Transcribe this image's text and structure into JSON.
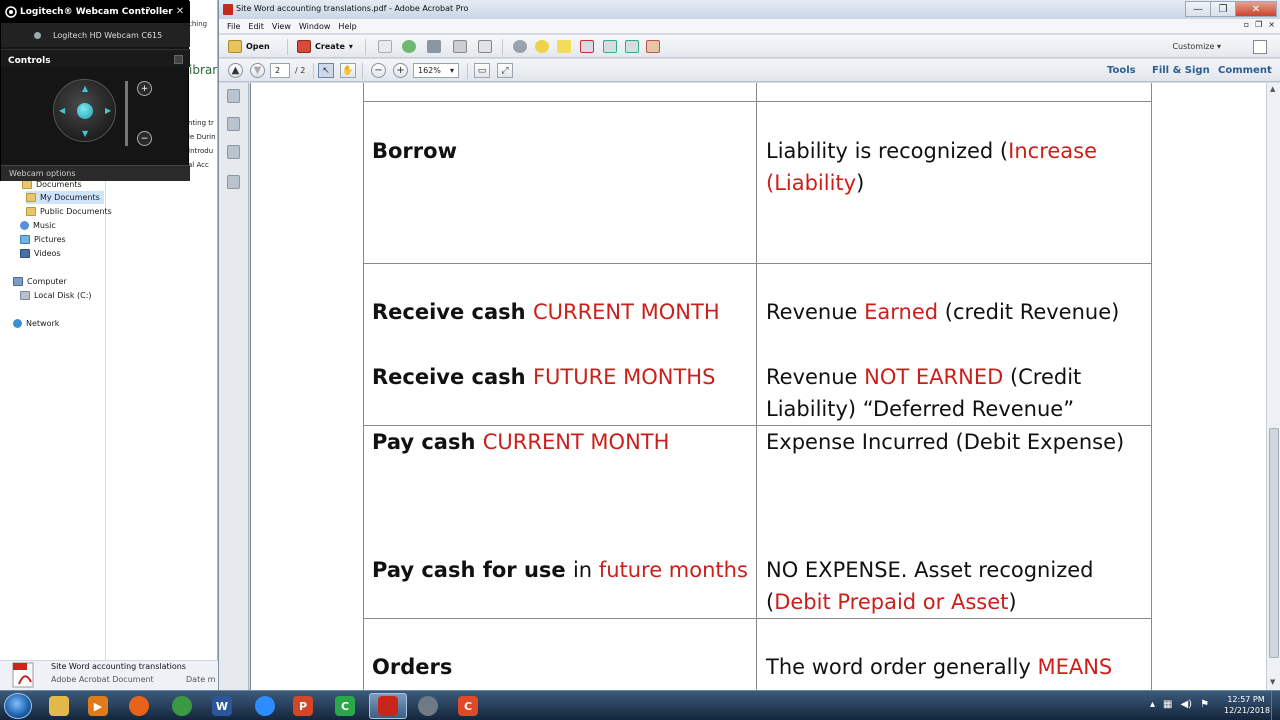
{
  "explorer": {
    "tree": [
      {
        "label": "Documents",
        "icon": "folder-icon",
        "indent": 1
      },
      {
        "label": "My Documents",
        "icon": "folder-icon",
        "indent": 2,
        "selected": true
      },
      {
        "label": "Public Documents",
        "icon": "folder-icon",
        "indent": 2
      },
      {
        "label": "Music",
        "icon": "music-icon",
        "indent": 1
      },
      {
        "label": "Pictures",
        "icon": "pictures-icon",
        "indent": 1
      },
      {
        "label": "Videos",
        "icon": "videos-icon",
        "indent": 1
      },
      {
        "label": "Computer",
        "icon": "computer-icon",
        "indent": 0
      },
      {
        "label": "Local Disk (C:)",
        "icon": "disk-icon",
        "indent": 1
      },
      {
        "label": "Network",
        "icon": "network-icon",
        "indent": 0
      }
    ],
    "title_fragment": "ching",
    "library_fragment": "ibrar",
    "file_fragments": [
      "nting tr",
      "le Durin",
      "Introdu",
      "al Acc"
    ],
    "status": {
      "title": "Site Word accounting translations",
      "type": "Adobe Acrobat Document",
      "date_label": "Date m"
    }
  },
  "webcam": {
    "title": "Logitech® Webcam Controller",
    "help_glyph": "?",
    "minimize_glyph": "—",
    "close_glyph": "✕",
    "device": "Logitech HD Webcam C615",
    "controls_label": "Controls",
    "options_label": "Webcam options"
  },
  "acrobat": {
    "title": "Site Word accounting translations.pdf - Adobe Acrobat Pro",
    "menu": [
      "File",
      "Edit",
      "View",
      "Window",
      "Help"
    ],
    "toolbar": {
      "open_label": "Open",
      "create_label": "Create",
      "customize_label": "Customize"
    },
    "nav": {
      "page_current": "2",
      "page_total": "/ 2",
      "zoom": "162%"
    },
    "right_links": {
      "tools": "Tools",
      "fill_sign": "Fill & Sign",
      "comment": "Comment"
    },
    "table_rows": [
      {
        "left": [
          {
            "text": "Borrow",
            "style": "bold"
          }
        ],
        "right_lines": [
          [
            {
              "text": "Liability is recognized (",
              "style": "normal"
            },
            {
              "text": "Increase",
              "style": "red"
            }
          ],
          [
            {
              "text": "(Liability",
              "style": "red"
            },
            {
              "text": ")",
              "style": "normal"
            }
          ]
        ]
      },
      {
        "left_1": [
          {
            "text": "Receive cash ",
            "style": "bold"
          },
          {
            "text": "CURRENT MONTH",
            "style": "red"
          }
        ],
        "right_1": [
          {
            "text": "Revenue ",
            "style": "normal"
          },
          {
            "text": "Earned",
            "style": "red"
          },
          {
            "text": " (credit Revenue)",
            "style": "normal"
          }
        ],
        "left_2": [
          {
            "text": "Receive cash ",
            "style": "bold"
          },
          {
            "text": "FUTURE MONTHS",
            "style": "red"
          }
        ],
        "right_2a": [
          {
            "text": "Revenue ",
            "style": "normal"
          },
          {
            "text": "NOT EARNED",
            "style": "red"
          },
          {
            "text": " (Credit",
            "style": "normal"
          }
        ],
        "right_2b": [
          {
            "text": "Liability) “Deferred Revenue”",
            "style": "normal"
          }
        ]
      },
      {
        "left_1": [
          {
            "text": "Pay cash ",
            "style": "bold"
          },
          {
            "text": "CURRENT MONTH",
            "style": "red"
          }
        ],
        "right_1": [
          {
            "text": "Expense Incurred (Debit Expense)",
            "style": "normal"
          }
        ],
        "left_2": [
          {
            "text": "Pay cash for use ",
            "style": "bold"
          },
          {
            "text": "in ",
            "style": "normal"
          },
          {
            "text": "future months",
            "style": "red"
          }
        ],
        "right_2a": [
          {
            "text": "NO EXPENSE. Asset recognized",
            "style": "normal"
          }
        ],
        "right_2b": [
          {
            "text": "(",
            "style": "normal"
          },
          {
            "text": "Debit Prepaid or Asset",
            "style": "red"
          },
          {
            "text": ")",
            "style": "normal"
          }
        ]
      },
      {
        "left": [
          {
            "text": "Orders",
            "style": "bold"
          }
        ],
        "right": [
          {
            "text": "The word order generally ",
            "style": "normal"
          },
          {
            "text": "MEANS",
            "style": "red"
          }
        ]
      }
    ]
  },
  "taskbar": {
    "apps": [
      {
        "name": "explorer",
        "glyph": "",
        "color": "#e0b94a"
      },
      {
        "name": "media",
        "glyph": "▶",
        "color": "#e07a1a"
      },
      {
        "name": "firefox",
        "glyph": "",
        "color": "#e8631a"
      },
      {
        "name": "chrome",
        "glyph": "",
        "color": "#3a9a44"
      },
      {
        "name": "word",
        "glyph": "W",
        "color": "#2b579a"
      },
      {
        "name": "zoom",
        "glyph": "",
        "color": "#2d8cff"
      },
      {
        "name": "powerpoint",
        "glyph": "P",
        "color": "#d24726"
      },
      {
        "name": "camtasia",
        "glyph": "C",
        "color": "#2aa84a"
      },
      {
        "name": "acrobat",
        "glyph": "",
        "color": "#c8251b"
      },
      {
        "name": "webcam",
        "glyph": "",
        "color": "#6e7a86"
      },
      {
        "name": "recorder",
        "glyph": "C",
        "color": "#e04a2a"
      }
    ],
    "active_app": "acrobat",
    "clock_time": "12:57 PM",
    "clock_date": "12/21/2018"
  },
  "colors": {
    "accent_red": "#cc1f1a",
    "link_blue": "#2b5e93"
  }
}
